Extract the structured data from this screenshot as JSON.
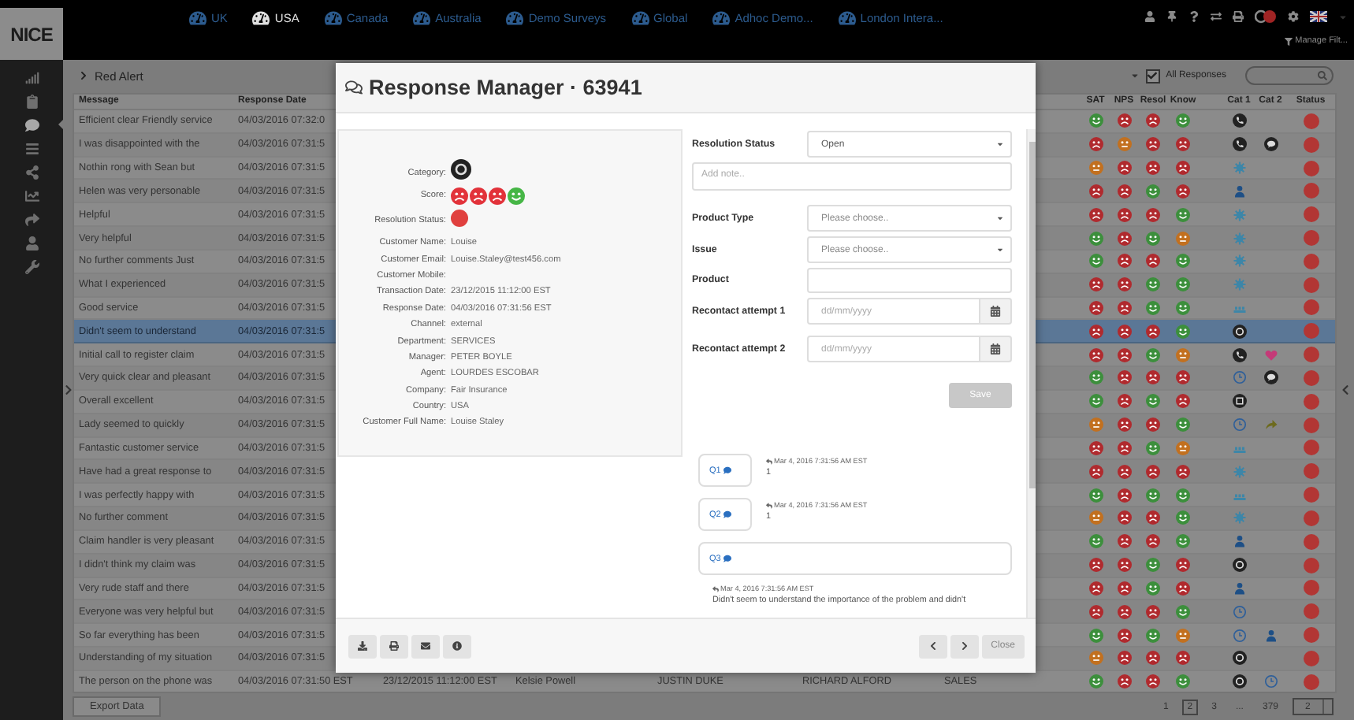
{
  "top_bar": {
    "logo": "NICE",
    "tabs": [
      {
        "label": "UK",
        "selected": false
      },
      {
        "label": "USA",
        "selected": true
      },
      {
        "label": "Canada",
        "selected": false
      },
      {
        "label": "Australia",
        "selected": false
      },
      {
        "label": "Demo Surveys",
        "selected": false
      },
      {
        "label": "Global",
        "selected": false
      },
      {
        "label": "Adhoc Demo...",
        "selected": false
      },
      {
        "label": "London Intera...",
        "selected": false
      }
    ],
    "manage_filter": "Manage Filt..."
  },
  "sidebar": {
    "items": [
      {
        "kind": "signal",
        "selected": false
      },
      {
        "kind": "clipboard",
        "selected": false
      },
      {
        "kind": "chat",
        "selected": true
      },
      {
        "kind": "list",
        "selected": false
      },
      {
        "kind": "share",
        "selected": false
      },
      {
        "kind": "chart",
        "selected": false
      },
      {
        "kind": "arrow",
        "selected": false
      },
      {
        "kind": "person",
        "selected": false
      },
      {
        "kind": "wrench",
        "selected": false
      }
    ]
  },
  "header": {
    "title": "Red Alert",
    "filter_checked": true,
    "filter_label": "All Responses"
  },
  "table": {
    "columns_left": [
      "Message",
      "Response Date"
    ],
    "columns_right": [
      "SAT",
      "NPS",
      "Resol",
      "Know",
      "Cat 1",
      "Cat 2",
      "Status"
    ],
    "rows": [
      {
        "cells": [
          "Efficient clear Friendly service",
          "04/03/2016 07:32:0"
        ],
        "scores": [
          {
            "kind": "good"
          },
          {
            "kind": "bad"
          },
          {
            "kind": "bad"
          },
          {
            "kind": "good"
          }
        ],
        "cat1": {
          "kind": "phone"
        },
        "selected": false
      },
      {
        "cells": [
          "I was disappointed with the",
          "04/03/2016 07:31:5"
        ],
        "scores": [
          {
            "kind": "bad"
          },
          {
            "kind": "neutral"
          },
          {
            "kind": "bad"
          },
          {
            "kind": "bad"
          }
        ],
        "cat1": {
          "kind": "phone"
        },
        "cat2": {
          "kind": "chat"
        },
        "selected": false
      },
      {
        "cells": [
          "Nothin rong with Sean but",
          "04/03/2016 07:31:5"
        ],
        "scores": [
          {
            "kind": "neutral"
          },
          {
            "kind": "bad"
          },
          {
            "kind": "bad"
          },
          {
            "kind": "bad"
          }
        ],
        "cat1": {
          "kind": "gear"
        },
        "selected": false
      },
      {
        "cells": [
          "Helen was very personable",
          "04/03/2016 07:31:5"
        ],
        "scores": [
          {
            "kind": "bad"
          },
          {
            "kind": "bad"
          },
          {
            "kind": "good"
          },
          {
            "kind": "bad"
          }
        ],
        "cat1": {
          "kind": "user"
        },
        "selected": false
      },
      {
        "cells": [
          "Helpful",
          "04/03/2016 07:31:5"
        ],
        "scores": [
          {
            "kind": "bad"
          },
          {
            "kind": "bad"
          },
          {
            "kind": "bad"
          },
          {
            "kind": "good"
          }
        ],
        "cat1": {
          "kind": "gear"
        },
        "selected": false
      },
      {
        "cells": [
          "Very helpful",
          "04/03/2016 07:31:5"
        ],
        "scores": [
          {
            "kind": "good"
          },
          {
            "kind": "bad"
          },
          {
            "kind": "good"
          },
          {
            "kind": "neutral"
          }
        ],
        "cat1": {
          "kind": "gear"
        },
        "selected": false
      },
      {
        "cells": [
          "No further comments Just",
          "04/03/2016 07:31:5"
        ],
        "scores": [
          {
            "kind": "good"
          },
          {
            "kind": "bad"
          },
          {
            "kind": "bad"
          },
          {
            "kind": "good"
          }
        ],
        "cat1": {
          "kind": "gear"
        },
        "selected": false
      },
      {
        "cells": [
          "What I experienced",
          "04/03/2016 07:31:5"
        ],
        "scores": [
          {
            "kind": "bad"
          },
          {
            "kind": "bad"
          },
          {
            "kind": "good"
          },
          {
            "kind": "good"
          }
        ],
        "cat1": {
          "kind": "gear"
        },
        "selected": false
      },
      {
        "cells": [
          "Good service",
          "04/03/2016 07:31:5"
        ],
        "scores": [
          {
            "kind": "bad"
          },
          {
            "kind": "bad"
          },
          {
            "kind": "good"
          },
          {
            "kind": "good"
          }
        ],
        "cat1": {
          "kind": "people"
        },
        "selected": false
      },
      {
        "cells": [
          "Didn't seem to understand",
          "04/03/2016 07:31:5"
        ],
        "scores": [
          {
            "kind": "bad"
          },
          {
            "kind": "bad"
          },
          {
            "kind": "bad"
          },
          {
            "kind": "good"
          }
        ],
        "cat1": {
          "kind": "ring"
        },
        "selected": true
      },
      {
        "cells": [
          "Initial call to register claim",
          "04/03/2016 07:31:5"
        ],
        "scores": [
          {
            "kind": "bad"
          },
          {
            "kind": "bad"
          },
          {
            "kind": "good"
          },
          {
            "kind": "neutral"
          }
        ],
        "cat1": {
          "kind": "phone"
        },
        "cat2": {
          "kind": "heart"
        },
        "selected": false
      },
      {
        "cells": [
          "Very quick clear and pleasant",
          "04/03/2016 07:31:5"
        ],
        "scores": [
          {
            "kind": "good"
          },
          {
            "kind": "bad"
          },
          {
            "kind": "bad"
          },
          {
            "kind": "bad"
          }
        ],
        "cat1": {
          "kind": "clock"
        },
        "cat2": {
          "kind": "chat"
        },
        "selected": false
      },
      {
        "cells": [
          "Overall excellent",
          "04/03/2016 07:31:5"
        ],
        "scores": [
          {
            "kind": "good"
          },
          {
            "kind": "bad"
          },
          {
            "kind": "good"
          },
          {
            "kind": "bad"
          }
        ],
        "cat1": {
          "kind": "grid"
        },
        "selected": false
      },
      {
        "cells": [
          "Lady seemed to quickly",
          "04/03/2016 07:31:5"
        ],
        "scores": [
          {
            "kind": "neutral"
          },
          {
            "kind": "bad"
          },
          {
            "kind": "bad"
          },
          {
            "kind": "good"
          }
        ],
        "cat1": {
          "kind": "clock"
        },
        "cat2": {
          "kind": "arrow"
        },
        "selected": false
      },
      {
        "cells": [
          "Fantastic customer service",
          "04/03/2016 07:31:5"
        ],
        "scores": [
          {
            "kind": "bad"
          },
          {
            "kind": "bad"
          },
          {
            "kind": "good"
          },
          {
            "kind": "neutral"
          }
        ],
        "cat1": {
          "kind": "people"
        },
        "selected": false
      },
      {
        "cells": [
          "Have had a great response to",
          "04/03/2016 07:31:5"
        ],
        "scores": [
          {
            "kind": "bad"
          },
          {
            "kind": "bad"
          },
          {
            "kind": "bad"
          },
          {
            "kind": "bad"
          }
        ],
        "cat1": {
          "kind": "gear"
        },
        "selected": false
      },
      {
        "cells": [
          "I was perfectly happy with",
          "04/03/2016 07:31:5"
        ],
        "scores": [
          {
            "kind": "good"
          },
          {
            "kind": "bad"
          },
          {
            "kind": "good"
          },
          {
            "kind": "good"
          }
        ],
        "cat1": {
          "kind": "people"
        },
        "selected": false
      },
      {
        "cells": [
          "No further comment",
          "04/03/2016 07:31:5"
        ],
        "scores": [
          {
            "kind": "neutral"
          },
          {
            "kind": "bad"
          },
          {
            "kind": "bad"
          },
          {
            "kind": "good"
          }
        ],
        "cat1": {
          "kind": "gear"
        },
        "selected": false
      },
      {
        "cells": [
          "Claim handler is very pleasant",
          "04/03/2016 07:31:5"
        ],
        "scores": [
          {
            "kind": "good"
          },
          {
            "kind": "bad"
          },
          {
            "kind": "bad"
          },
          {
            "kind": "good"
          }
        ],
        "cat1": {
          "kind": "user"
        },
        "selected": false
      },
      {
        "cells": [
          "I didn't think my claim was",
          "04/03/2016 07:31:5"
        ],
        "scores": [
          {
            "kind": "bad"
          },
          {
            "kind": "bad"
          },
          {
            "kind": "good"
          },
          {
            "kind": "bad"
          }
        ],
        "cat1": {
          "kind": "ring"
        },
        "selected": false
      },
      {
        "cells": [
          "Very rude staff and there",
          "04/03/2016 07:31:5"
        ],
        "scores": [
          {
            "kind": "bad"
          },
          {
            "kind": "bad"
          },
          {
            "kind": "good"
          },
          {
            "kind": "bad"
          }
        ],
        "cat1": {
          "kind": "user"
        },
        "selected": false
      },
      {
        "cells": [
          "Everyone was very helpful but",
          "04/03/2016 07:31:5"
        ],
        "scores": [
          {
            "kind": "bad"
          },
          {
            "kind": "bad"
          },
          {
            "kind": "bad"
          },
          {
            "kind": "good"
          }
        ],
        "cat1": {
          "kind": "clock"
        },
        "selected": false
      },
      {
        "cells": [
          "So far everything has been",
          "04/03/2016 07:31:5"
        ],
        "scores": [
          {
            "kind": "good"
          },
          {
            "kind": "bad"
          },
          {
            "kind": "good"
          },
          {
            "kind": "neutral"
          }
        ],
        "cat1": {
          "kind": "clock"
        },
        "cat2": {
          "kind": "user"
        },
        "selected": false
      },
      {
        "cells": [
          "Understanding of my situation",
          "04/03/2016 07:31:5"
        ],
        "scores": [
          {
            "kind": "neutral"
          },
          {
            "kind": "bad"
          },
          {
            "kind": "bad"
          },
          {
            "kind": "bad"
          }
        ],
        "cat1": {
          "kind": "ring"
        },
        "selected": false
      },
      {
        "cells": [
          "The person on the phone was",
          "04/03/2016 07:31:50 EST",
          "23/12/2015 11:12:00 EST",
          "Kelsie Powell",
          "JUSTIN DUKE",
          "RICHARD ALFORD",
          "SALES"
        ],
        "scores": [
          {
            "kind": "good"
          },
          {
            "kind": "bad"
          },
          {
            "kind": "bad"
          },
          {
            "kind": "good"
          }
        ],
        "cat1": {
          "kind": "ring"
        },
        "cat2": {
          "kind": "clock"
        },
        "selected": false
      }
    ]
  },
  "footer": {
    "export_button": "Export Data",
    "pages": [
      {
        "label": "1",
        "selected": false
      },
      {
        "label": "2",
        "selected": true
      },
      {
        "label": "3",
        "selected": false
      },
      {
        "label": "...",
        "selected": false
      },
      {
        "label": "379",
        "selected": false
      }
    ],
    "page_input": "2"
  },
  "modal": {
    "title": "Response Manager · 63941",
    "details": [
      {
        "label": "Category:",
        "kind": "category",
        "symbol": {
          "kind": "ring"
        }
      },
      {
        "label": "Score:",
        "kind": "score",
        "faces": [
          {
            "kind": "bad"
          },
          {
            "kind": "bad"
          },
          {
            "kind": "bad"
          },
          {
            "kind": "good"
          }
        ]
      },
      {
        "label": "Resolution Status:",
        "kind": "status"
      },
      {
        "label": "Customer Name:",
        "kind": "text",
        "value": "Louise"
      },
      {
        "label": "Customer Email:",
        "kind": "text",
        "value": "Louise.Staley@test456.com"
      },
      {
        "label": "Customer Mobile:",
        "kind": "text"
      },
      {
        "label": "Transaction Date:",
        "kind": "text",
        "value": "23/12/2015 11:12:00 EST"
      },
      {
        "label": "Response Date:",
        "kind": "text",
        "value": "04/03/2016 07:31:56 EST"
      },
      {
        "label": "Channel:",
        "kind": "text",
        "value": "external"
      },
      {
        "label": "Department:",
        "kind": "text",
        "value": "SERVICES"
      },
      {
        "label": "Manager:",
        "kind": "text",
        "value": "PETER BOYLE"
      },
      {
        "label": "Agent:",
        "kind": "text",
        "value": "LOURDES ESCOBAR"
      },
      {
        "label": "Company:",
        "kind": "text",
        "value": "Fair Insurance"
      },
      {
        "label": "Country:",
        "kind": "text",
        "value": "USA"
      },
      {
        "label": "Customer Full Name:",
        "kind": "text",
        "value": "Louise Staley"
      }
    ],
    "form": [
      {
        "kind": "select",
        "label": "Resolution Status",
        "value": "Open"
      },
      {
        "kind": "textarea",
        "placeholder": "Add note.."
      },
      {
        "kind": "select",
        "label": "Product Type",
        "placeholder": "Please choose.."
      },
      {
        "kind": "select",
        "label": "Issue",
        "placeholder": "Please choose.."
      },
      {
        "kind": "input",
        "label": "Product"
      },
      {
        "kind": "date",
        "label": "Recontact attempt 1",
        "placeholder": "dd/mm/yyyy"
      },
      {
        "kind": "date",
        "label": "Recontact attempt 2",
        "placeholder": "dd/mm/yyyy"
      }
    ],
    "save": {
      "label": "Save",
      "disabled": true
    },
    "comments": [
      {
        "kind": "side",
        "label": "Q1",
        "time": "Mar 4, 2016 7:31:56 AM EST",
        "text": "1"
      },
      {
        "kind": "side",
        "label": "Q2",
        "time": "Mar 4, 2016 7:31:56 AM EST",
        "text": "1"
      },
      {
        "kind": "below",
        "label": "Q3",
        "time": "Mar 4, 2016 7:31:56 AM EST",
        "text": "Didn't seem to understand the importance of the problem and didn't"
      }
    ],
    "close": "Close"
  }
}
